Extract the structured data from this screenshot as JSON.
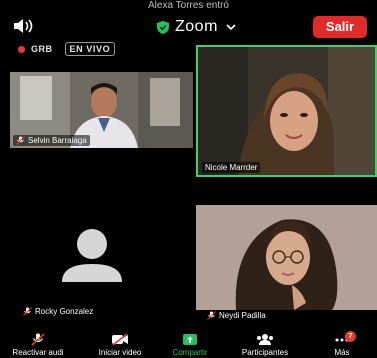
{
  "notice": "Alexa Torres entró",
  "header": {
    "app_name": "Zoom",
    "leave_label": "Salir"
  },
  "recording": {
    "rec_label": "GRB",
    "live_label": "EN VIVO"
  },
  "participants": [
    {
      "name": "Selvin Barraiaga"
    },
    {
      "name": "Nicole Marrder"
    },
    {
      "name": "Rocky Gonzalez"
    },
    {
      "name": "Neydi Padilla"
    }
  ],
  "toolbar": {
    "unmute_label": "Reactivar audi",
    "start_video_label": "Iniciar video",
    "share_label": "Compartir",
    "participants_label": "Participantes",
    "more_label": "Más",
    "more_badge": "7"
  },
  "colors": {
    "leave_button": "#e02b2b",
    "active_speaker_border": "#3bd16f",
    "share_green": "#24c25a",
    "badge_red": "#e53935"
  }
}
